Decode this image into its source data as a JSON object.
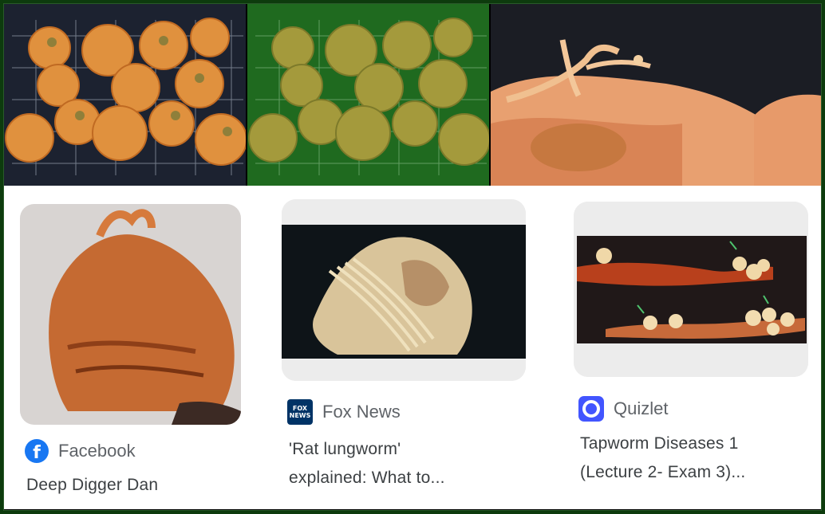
{
  "top_images": [
    {
      "name": "fried-fritters-on-rack"
    },
    {
      "name": "fried-fritters-green-filter"
    },
    {
      "name": "fritter-closeup-with-worm"
    }
  ],
  "results": [
    {
      "source": "Facebook",
      "title": "Deep Digger Dan",
      "icon": "facebook-icon",
      "brand_color": "#1877f2"
    },
    {
      "source": "Fox News",
      "title": "'Rat lungworm' explained: What to...",
      "title_line1": "'Rat lungworm'",
      "title_line2": "explained: What to...",
      "icon": "fox-news-icon",
      "brand_color": "#003366",
      "favicon_text": "FOX NEWS"
    },
    {
      "source": "Quizlet",
      "title": "Tapworm Diseases 1 (Lecture 2- Exam 3)...",
      "title_line1": "Tapworm Diseases 1",
      "title_line2": "(Lecture 2- Exam 3)...",
      "icon": "quizlet-icon",
      "brand_color": "#4255ff"
    }
  ]
}
